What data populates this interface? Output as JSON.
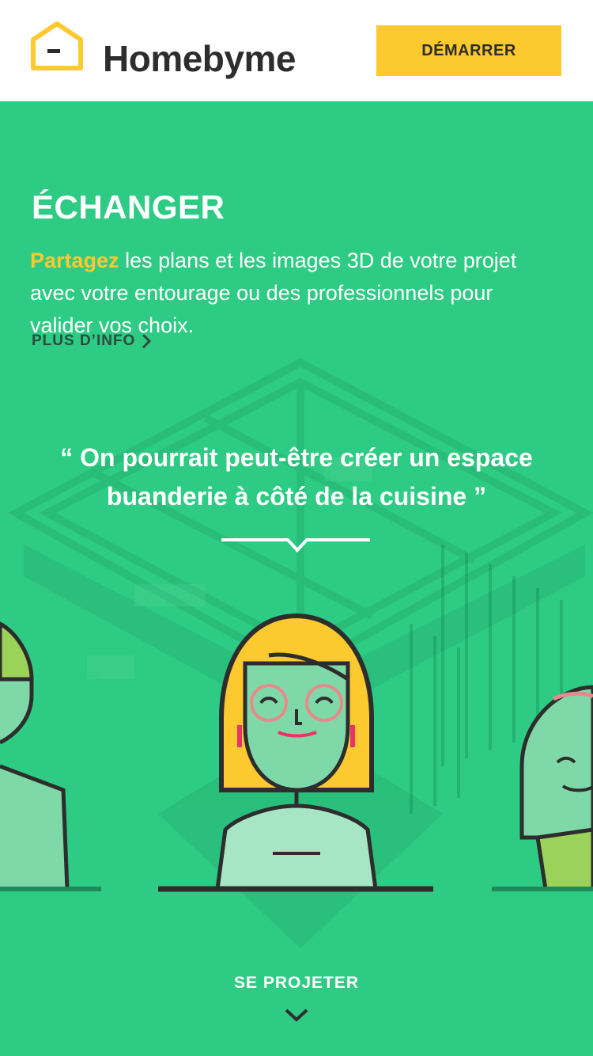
{
  "header": {
    "brand": "Homebyme",
    "cta_label": "DÉMARRER"
  },
  "section": {
    "title": "ÉCHANGER",
    "description_highlight": "Partagez",
    "description_rest": " les plans et les images 3D de votre projet avec votre entourage ou des professionnels pour valider vos choix.",
    "more_label": "PLUS D’INFO",
    "quote": "“ On pourrait peut-être créer un espace buanderie à côté de la cuisine ”"
  },
  "footer": {
    "next_label": "SE PROJETER"
  },
  "colors": {
    "primary_green": "#2ecb84",
    "accent_yellow": "#fcc92e",
    "dark_text": "#2d2d2d"
  },
  "icons": [
    "house-logo-icon",
    "chevron-right-icon",
    "chevron-down-icon"
  ]
}
